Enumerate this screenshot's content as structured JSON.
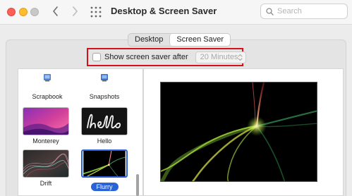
{
  "window": {
    "title": "Desktop & Screen Saver",
    "search_placeholder": "Search"
  },
  "tabs": [
    {
      "label": "Desktop",
      "active": false
    },
    {
      "label": "Screen Saver",
      "active": true
    }
  ],
  "screen_saver_after": {
    "label": "Show screen saver after",
    "checked": false,
    "value": "20 Minutes"
  },
  "modules": [
    {
      "label": "Scrapbook"
    },
    {
      "label": "Snapshots"
    },
    {
      "label": "Monterey"
    },
    {
      "label": "Hello"
    },
    {
      "label": "Drift"
    },
    {
      "label": "Flurry",
      "selected": true
    }
  ],
  "colors": {
    "highlight_box": "#d5121c",
    "selection": "#2b63d6"
  }
}
